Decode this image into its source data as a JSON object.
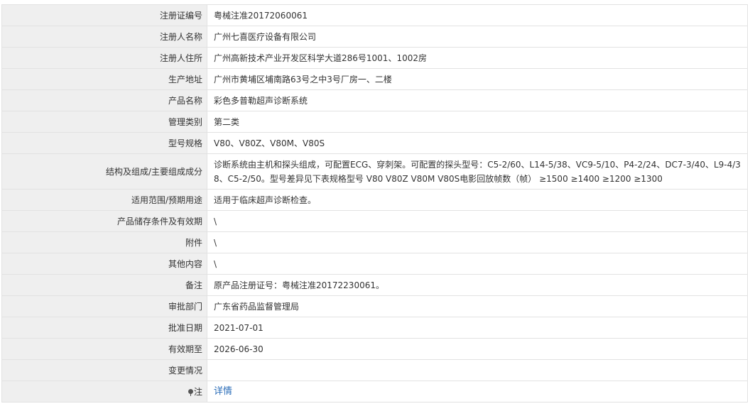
{
  "rows": [
    {
      "label": "注册证编号",
      "value": "粤械注准20172060061"
    },
    {
      "label": "注册人名称",
      "value": "广州七喜医疗设备有限公司"
    },
    {
      "label": "注册人住所",
      "value": "广州高新技术产业开发区科学大道286号1001、1002房"
    },
    {
      "label": "生产地址",
      "value": "广州市黄埔区埔南路63号之中3号厂房一、二楼"
    },
    {
      "label": "产品名称",
      "value": "彩色多普勒超声诊断系统"
    },
    {
      "label": "管理类别",
      "value": "第二类"
    },
    {
      "label": "型号规格",
      "value": "V80、V80Z、V80M、V80S"
    },
    {
      "label": "结构及组成/主要组成成分",
      "value": "诊断系统由主机和探头组成，可配置ECG、穿刺架。可配置的探头型号：C5-2/60、L14-5/38、VC9-5/10、P4-2/24、DC7-3/40、L9-4/38、C5-2/50。型号差异见下表规格型号 V80 V80Z V80M V80S电影回放帧数（帧） ≥1500 ≥1400 ≥1200 ≥1300"
    },
    {
      "label": "适用范围/预期用途",
      "value": "适用于临床超声诊断检查。"
    },
    {
      "label": "产品储存条件及有效期",
      "value": "\\"
    },
    {
      "label": "附件",
      "value": "\\"
    },
    {
      "label": "其他内容",
      "value": "\\"
    },
    {
      "label": "备注",
      "value": "原产品注册证号：粤械注准20172230061。"
    },
    {
      "label": "审批部门",
      "value": "广东省药品监督管理局"
    },
    {
      "label": "批准日期",
      "value": "2021-07-01"
    },
    {
      "label": "有效期至",
      "value": "2026-06-30"
    },
    {
      "label": "变更情况",
      "value": ""
    },
    {
      "label": "注",
      "value": "详情"
    }
  ],
  "icons": {
    "note": "map-pin-icon"
  },
  "colors": {
    "label_bg": "#efefef",
    "border": "#e2e2e2",
    "link": "#2a6cb8"
  }
}
